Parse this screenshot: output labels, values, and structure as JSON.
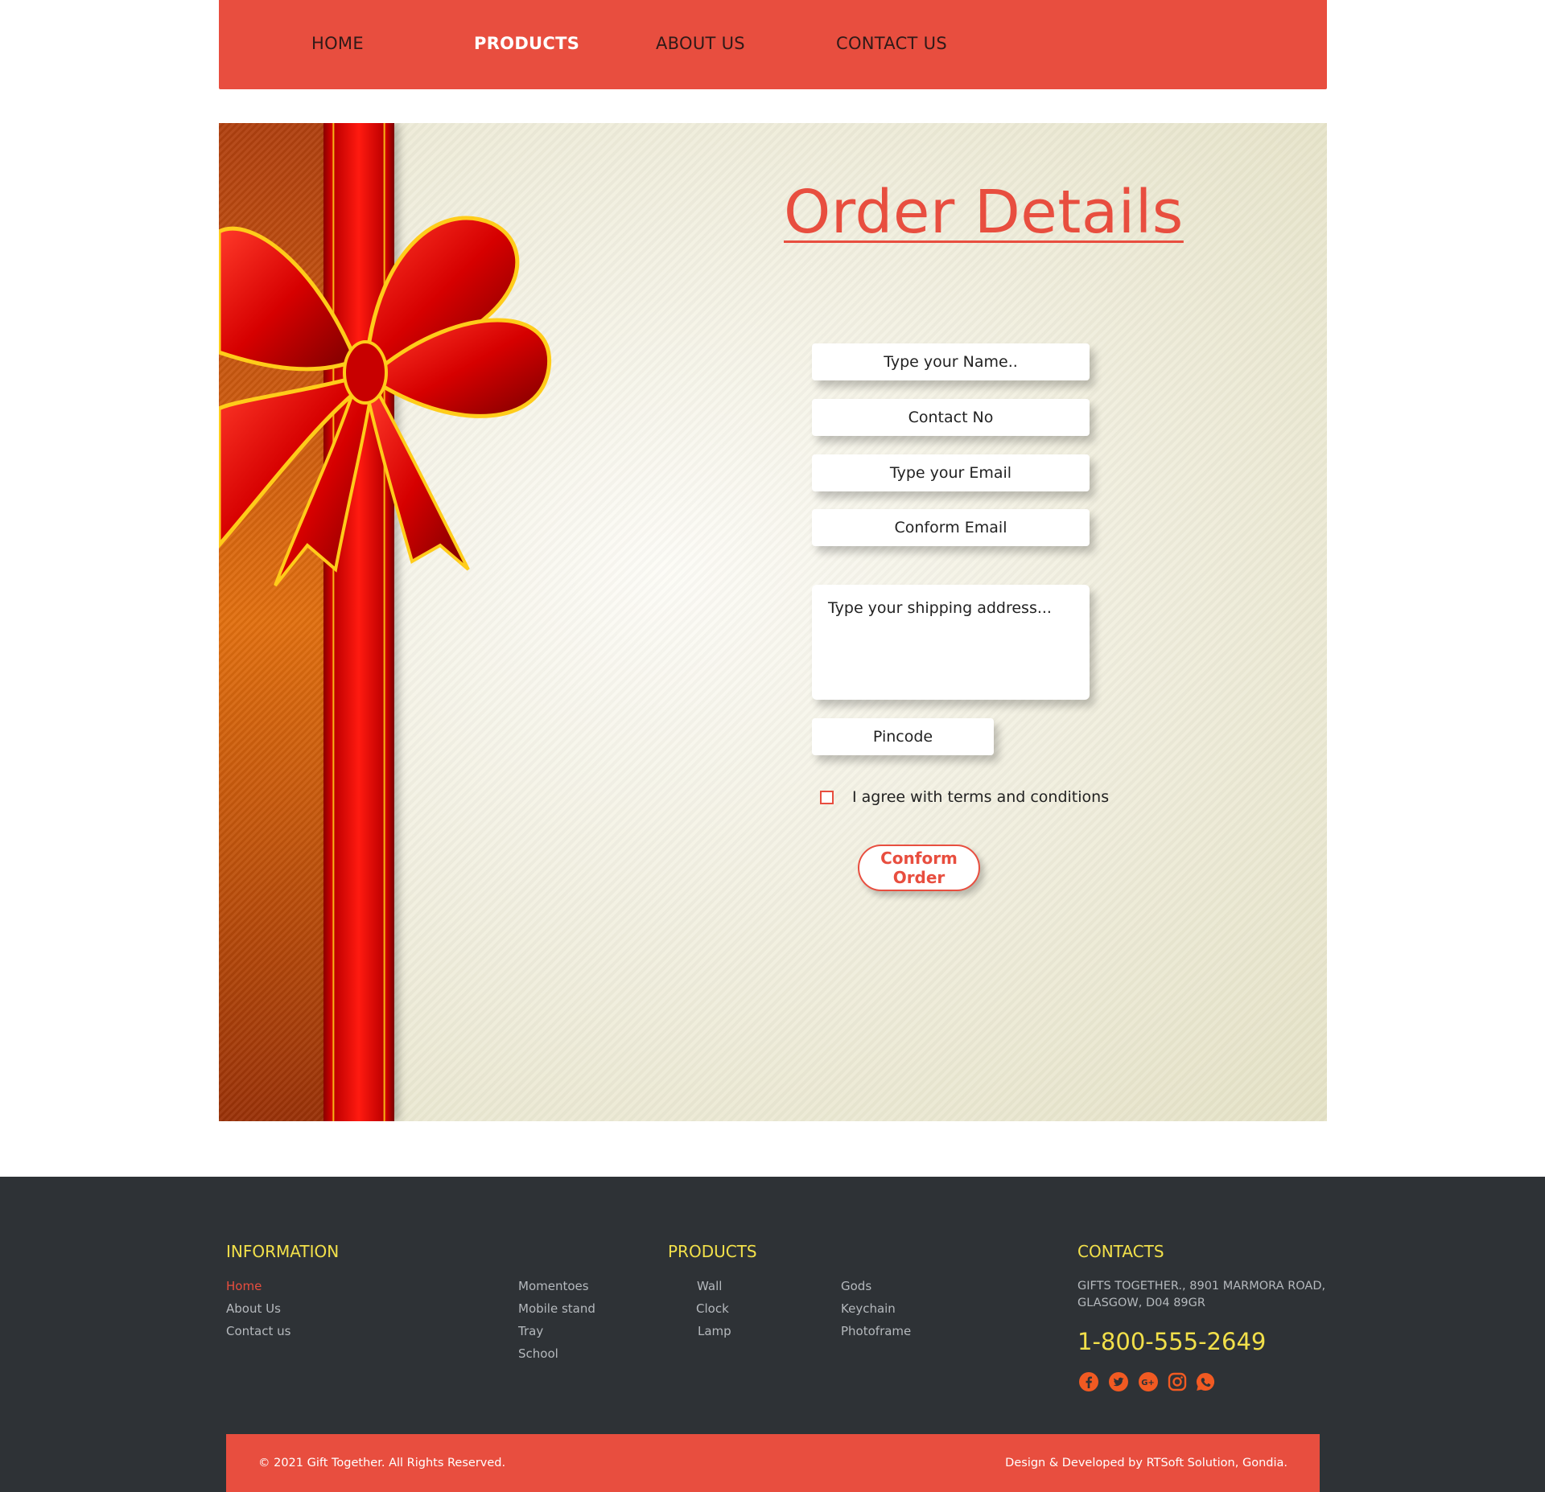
{
  "nav": {
    "items": [
      "HOME",
      "PRODUCTS",
      "ABOUT US",
      "CONTACT US"
    ],
    "active": "PRODUCTS"
  },
  "order": {
    "title": "Order Details",
    "name_placeholder": "Type your Name..",
    "contact_placeholder": "Contact No",
    "email_placeholder": "Type your Email",
    "confirm_email_placeholder": "Conform Email",
    "address_placeholder": "Type your shipping address...",
    "pincode_placeholder": "Pincode",
    "terms_label": "I agree with terms and conditions",
    "submit_label": "Conform Order"
  },
  "footer": {
    "information": {
      "heading": "INFORMATION",
      "links": [
        "Home",
        "About Us",
        "Contact us"
      ]
    },
    "products": {
      "heading": "PRODUCTS",
      "col1": [
        "Momentoes",
        "Mobile stand",
        "Tray",
        "School"
      ],
      "col2": [
        "Wall",
        "Clock",
        "Lamp"
      ],
      "col3": [
        "Gods",
        "Keychain",
        "Photoframe"
      ]
    },
    "contacts": {
      "heading": "CONTACTS",
      "address": "GIFTS TOGETHER., 8901 MARMORA ROAD, GLASGOW, D04 89GR",
      "phone": "1-800-555-2649",
      "social_icons": [
        "facebook-icon",
        "twitter-icon",
        "google-plus-icon",
        "instagram-icon",
        "whatsapp-icon"
      ]
    },
    "copyright": "© 2021 Gift Together. All Rights Reserved.",
    "credit": "Design & Developed by RTSoft Solution, Gondia."
  },
  "colors": {
    "accent": "#e84e3f",
    "footer_bg": "#2e3236",
    "footer_heading": "#f2e04a",
    "social_icon": "#f15a22"
  }
}
